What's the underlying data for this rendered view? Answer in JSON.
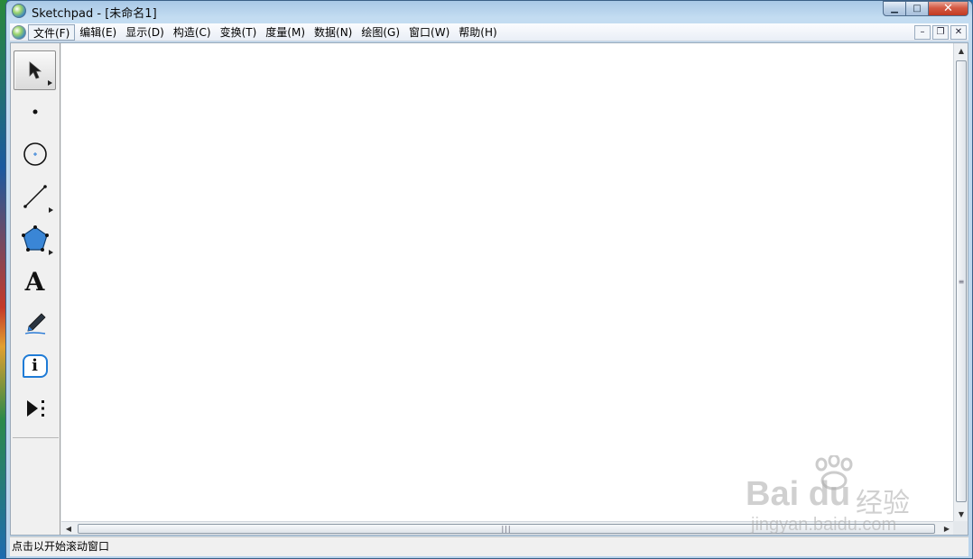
{
  "window": {
    "title": "Sketchpad  - [未命名1]",
    "min_glyph": "▁",
    "max_glyph": "□",
    "close_glyph": "✕"
  },
  "menubar": {
    "items": [
      "文件(F)",
      "编辑(E)",
      "显示(D)",
      "构造(C)",
      "变换(T)",
      "度量(M)",
      "数据(N)",
      "绘图(G)",
      "窗口(W)",
      "帮助(H)"
    ],
    "active_index": 0,
    "mdi_min": "–",
    "mdi_restore": "❐",
    "mdi_close": "✕"
  },
  "toolbox": {
    "tools": [
      {
        "name": "arrow-tool",
        "icon": "arrow-select-icon",
        "selected": true,
        "has_more": true
      },
      {
        "name": "point-tool",
        "icon": "point-icon",
        "selected": false,
        "has_more": false
      },
      {
        "name": "compass-tool",
        "icon": "circle-icon",
        "selected": false,
        "has_more": false
      },
      {
        "name": "straightedge-tool",
        "icon": "segment-icon",
        "selected": false,
        "has_more": true
      },
      {
        "name": "polygon-tool",
        "icon": "polygon-icon",
        "selected": false,
        "has_more": true
      },
      {
        "name": "text-tool",
        "icon": "text-icon",
        "selected": false,
        "has_more": false
      },
      {
        "name": "marker-tool",
        "icon": "marker-icon",
        "selected": false,
        "has_more": false
      },
      {
        "name": "information-tool",
        "icon": "info-icon",
        "selected": false,
        "has_more": false
      },
      {
        "name": "custom-tool",
        "icon": "custom-tool-icon",
        "selected": false,
        "has_more": false
      }
    ],
    "text_glyph": "A",
    "info_glyph": "i"
  },
  "scrollbars": {
    "up_glyph": "▲",
    "down_glyph": "▼",
    "left_glyph": "◀",
    "right_glyph": "▶",
    "grip_glyph": "≡"
  },
  "statusbar": {
    "text": "点击以开始滚动窗口"
  },
  "watermark": {
    "brand": "Bai du",
    "product": "经验",
    "url": "jingyan.baidu.com"
  },
  "colors": {
    "polygon_fill": "#3a86d6",
    "info_blue": "#1f7bd6",
    "close_red": "#c23a22"
  }
}
